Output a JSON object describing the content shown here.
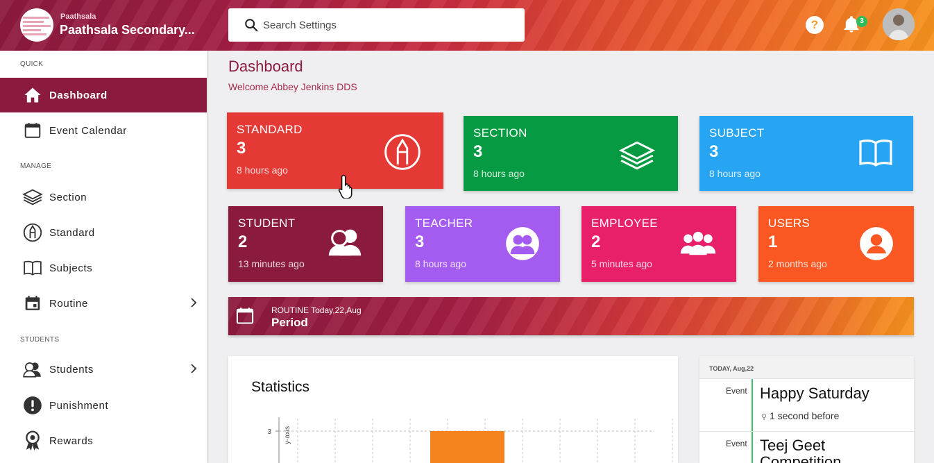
{
  "header": {
    "school_small": "Paathsala",
    "school_name": "Paathsala Secondary...",
    "search_placeholder": "Search Settings",
    "help_label": "?",
    "notification_count": "3"
  },
  "sidebar": {
    "sections": {
      "quick": "QUICK",
      "manage": "MANAGE",
      "students": "STUDENTS"
    },
    "items": [
      {
        "label": "Dashboard",
        "icon": "home-icon",
        "active": true
      },
      {
        "label": "Event Calendar",
        "icon": "calendar-icon"
      },
      {
        "label": "Section",
        "icon": "layers-icon"
      },
      {
        "label": "Standard",
        "icon": "pencil-circle-icon"
      },
      {
        "label": "Subjects",
        "icon": "book-icon"
      },
      {
        "label": "Routine",
        "icon": "calendar-icon",
        "has_submenu": true
      },
      {
        "label": "Students",
        "icon": "users-icon",
        "has_submenu": true
      },
      {
        "label": "Punishment",
        "icon": "alert-icon"
      },
      {
        "label": "Rewards",
        "icon": "award-icon"
      }
    ]
  },
  "main": {
    "title": "Dashboard",
    "welcome": "Welcome Abbey Jenkins DDS"
  },
  "cards": [
    {
      "title": "STANDARD",
      "count": "3",
      "time": "8 hours ago",
      "color": "#e53935",
      "icon": "pencil-circle-icon"
    },
    {
      "title": "SECTION",
      "count": "3",
      "time": "8 hours ago",
      "color": "#069a42",
      "icon": "layers-icon"
    },
    {
      "title": "SUBJECT",
      "count": "3",
      "time": "8 hours ago",
      "color": "#27a4f2",
      "icon": "book-icon"
    },
    {
      "title": "STUDENT",
      "count": "2",
      "time": "13 minutes ago",
      "color": "#8b1a3f",
      "icon": "users-icon"
    },
    {
      "title": "TEACHER",
      "count": "3",
      "time": "8 hours ago",
      "color": "#a45bf0",
      "icon": "teacher-icon"
    },
    {
      "title": "EMPLOYEE",
      "count": "2",
      "time": "5 minutes ago",
      "color": "#e8206a",
      "icon": "group-icon"
    },
    {
      "title": "USERS",
      "count": "1",
      "time": "2 months ago",
      "color": "#fb5722",
      "icon": "user-circle-icon"
    }
  ],
  "routine": {
    "label": "ROUTINE Today,22,Aug",
    "value": "Period"
  },
  "statistics": {
    "title": "Statistics",
    "y_axis_label": "y-axis",
    "y_tick": "3",
    "bar_color": "#f5841f"
  },
  "chart_data": {
    "type": "bar",
    "title": "Statistics",
    "ylabel": "y-axis",
    "ytick_labels": [
      "3"
    ],
    "values": [
      3
    ]
  },
  "events": {
    "header": "TODAY, Aug,22",
    "items": [
      {
        "kind": "Event",
        "title": "Happy Saturday",
        "time": "1 second before"
      },
      {
        "kind": "Event",
        "title": "Teej Geet Competition",
        "time": ""
      }
    ]
  }
}
